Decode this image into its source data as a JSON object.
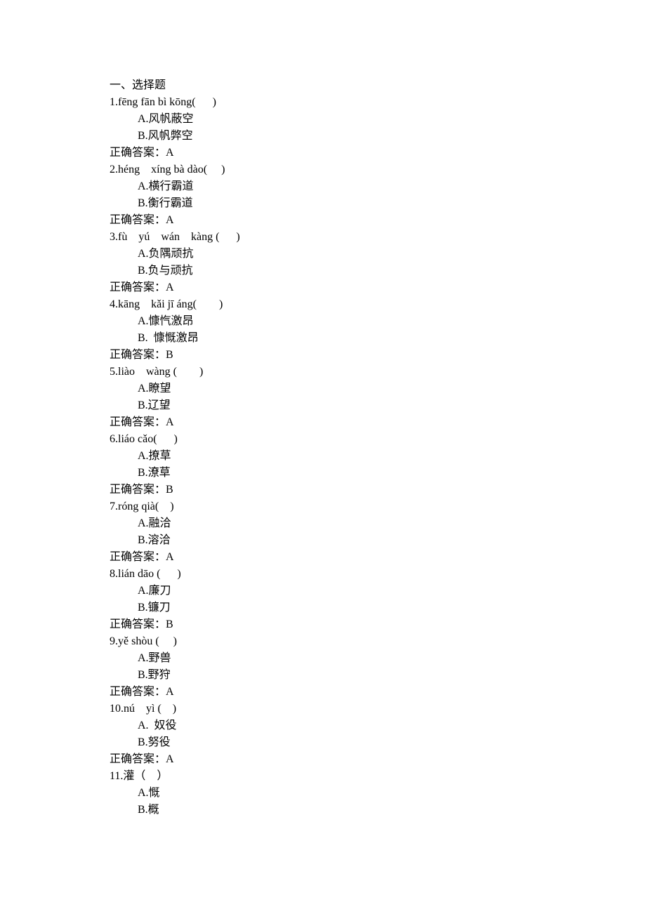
{
  "section_title": "一、选择题",
  "answer_label_prefix": "正确答案：",
  "questions": [
    {
      "num": "1",
      "pinyin": "fēng fān bì kōng(      )",
      "options": [
        "A.风帆蔽空",
        "B.风帆弊空"
      ],
      "answer": "A"
    },
    {
      "num": "2",
      "pinyin": "héng    xíng bà dào(     )",
      "options": [
        "A.横行霸道",
        "B.衡行霸道"
      ],
      "answer": "A"
    },
    {
      "num": "3",
      "pinyin": "fù    yú    wán    kàng (      )",
      "options": [
        "A.负隅顽抗",
        "B.负与顽抗"
      ],
      "answer": "A"
    },
    {
      "num": "4",
      "pinyin": "kāng    kǎi jī áng(        )",
      "options": [
        "A.慷忾激昂",
        "B.  慷慨激昂"
      ],
      "answer": "B"
    },
    {
      "num": "5",
      "pinyin": "liào    wàng (        )",
      "options": [
        "A.瞭望",
        "B.辽望"
      ],
      "answer": "A"
    },
    {
      "num": "6",
      "pinyin": "liáo cǎo(      )",
      "options": [
        "A.撩草",
        "B.潦草"
      ],
      "answer": "B"
    },
    {
      "num": "7",
      "pinyin": "róng qià(    )",
      "options": [
        "A.融洽",
        "B.溶洽"
      ],
      "answer": "A"
    },
    {
      "num": "8",
      "pinyin": "lián dāo (      )",
      "options": [
        "A.廉刀",
        "B.镰刀"
      ],
      "answer": "B"
    },
    {
      "num": "9",
      "pinyin": "yě shòu (     )",
      "options": [
        "A.野兽",
        "B.野狩"
      ],
      "answer": "A"
    },
    {
      "num": "10",
      "pinyin": "nú    yì (    )",
      "options": [
        "A.  奴役",
        "B.努役"
      ],
      "answer": "A"
    },
    {
      "num": "11",
      "pinyin": "灌（    ）",
      "options": [
        "A.慨",
        "B.概"
      ],
      "answer": ""
    }
  ]
}
